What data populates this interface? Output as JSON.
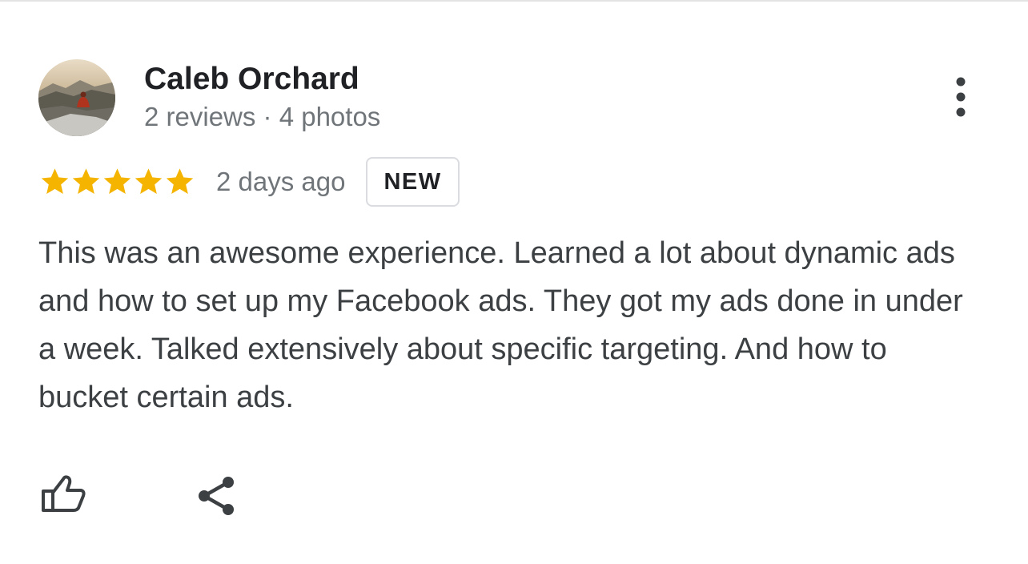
{
  "review": {
    "reviewer_name": "Caleb Orchard",
    "reviewer_meta": "2 reviews · 4 photos",
    "rating": 5,
    "rating_max": 5,
    "date": "2 days ago",
    "badge": "NEW",
    "text": "This was an awesome experience. Learned a lot about dynamic ads and how to set up my Facebook ads. They got my ads done in under a week. Talked extensively about specific targeting. And how to bucket certain ads."
  },
  "icons": {
    "avatar": "avatar-photo",
    "more": "more-vert-icon",
    "star": "star-icon",
    "like": "thumbs-up-icon",
    "share": "share-icon"
  },
  "colors": {
    "star": "#f4b400",
    "name": "#202124",
    "secondary": "#70757a",
    "body_text": "#3c4043",
    "icon": "#3c4043",
    "badge_border": "#dadce0"
  }
}
